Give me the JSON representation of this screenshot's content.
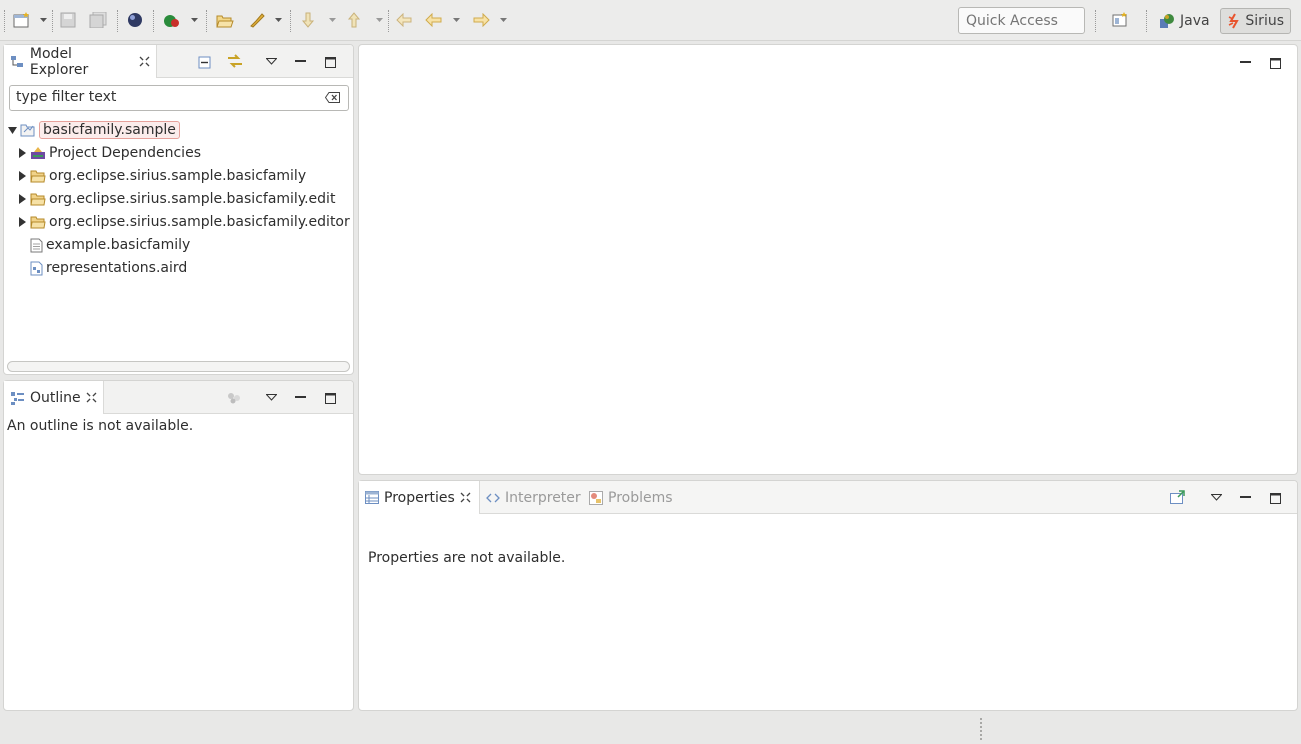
{
  "toolbar": {
    "quick_access_placeholder": "Quick Access",
    "perspectives": [
      {
        "label": "Java",
        "active": false
      },
      {
        "label": "Sirius",
        "active": true
      }
    ]
  },
  "model_explorer": {
    "tab_label": "Model Explorer",
    "filter_placeholder": "type filter text",
    "tree": [
      {
        "label": "basicfamily.sample",
        "expanded": true,
        "icon": "project-icon",
        "selected": true
      },
      {
        "label": "Project Dependencies",
        "expanded": false,
        "icon": "dependencies-icon"
      },
      {
        "label": "org.eclipse.sirius.sample.basicfamily",
        "expanded": false,
        "icon": "folder-icon"
      },
      {
        "label": "org.eclipse.sirius.sample.basicfamily.edit",
        "expanded": false,
        "icon": "folder-icon"
      },
      {
        "label": "org.eclipse.sirius.sample.basicfamily.editor",
        "expanded": false,
        "icon": "folder-icon"
      },
      {
        "label": "example.basicfamily",
        "icon": "file-icon"
      },
      {
        "label": "representations.aird",
        "icon": "aird-file-icon"
      }
    ]
  },
  "outline": {
    "tab_label": "Outline",
    "message": "An outline is not available."
  },
  "bottom_panel": {
    "tabs": [
      {
        "label": "Properties",
        "active": true
      },
      {
        "label": "Interpreter",
        "active": false
      },
      {
        "label": "Problems",
        "active": false
      }
    ],
    "message": "Properties are not available."
  },
  "colors": {
    "selection_border": "#e6a19b",
    "folder": "#e9b54a",
    "sirius_accent": "#e8542e"
  }
}
